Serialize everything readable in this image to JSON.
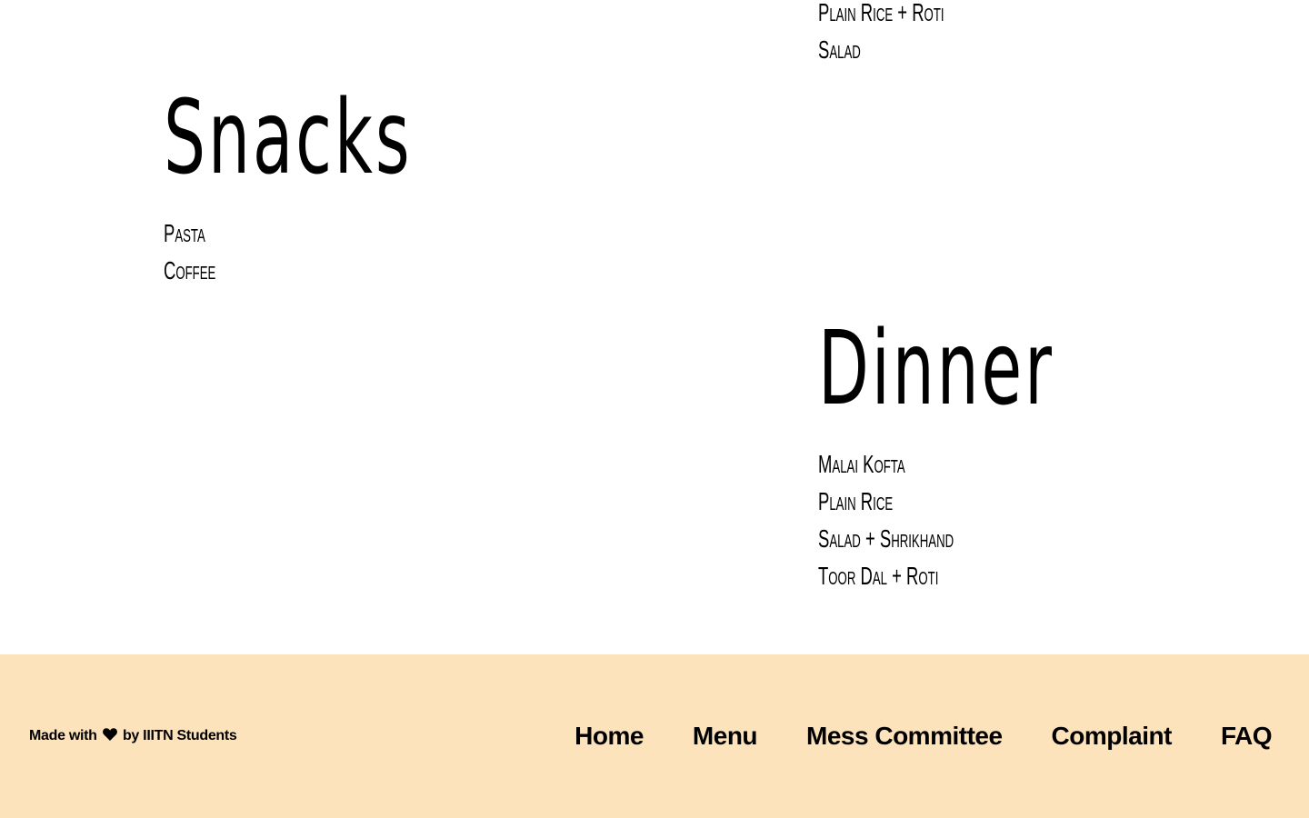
{
  "menu": {
    "lunch": {
      "items": [
        "Plain Rice + Roti",
        "Salad"
      ]
    },
    "snacks": {
      "title": "Snacks",
      "items": [
        "Pasta",
        "Coffee"
      ]
    },
    "dinner": {
      "title": "Dinner",
      "items": [
        "Malai Kofta",
        "Plain Rice",
        "Salad + Shrikhand",
        "Toor Dal + Roti"
      ]
    }
  },
  "footer": {
    "credit_prefix": "Made with",
    "credit_icon": "heart-icon",
    "credit_suffix": "by IIITN Students",
    "background": "#fde3bb",
    "nav": [
      "Home",
      "Menu",
      "Mess Committee",
      "Complaint",
      "FAQ"
    ]
  }
}
